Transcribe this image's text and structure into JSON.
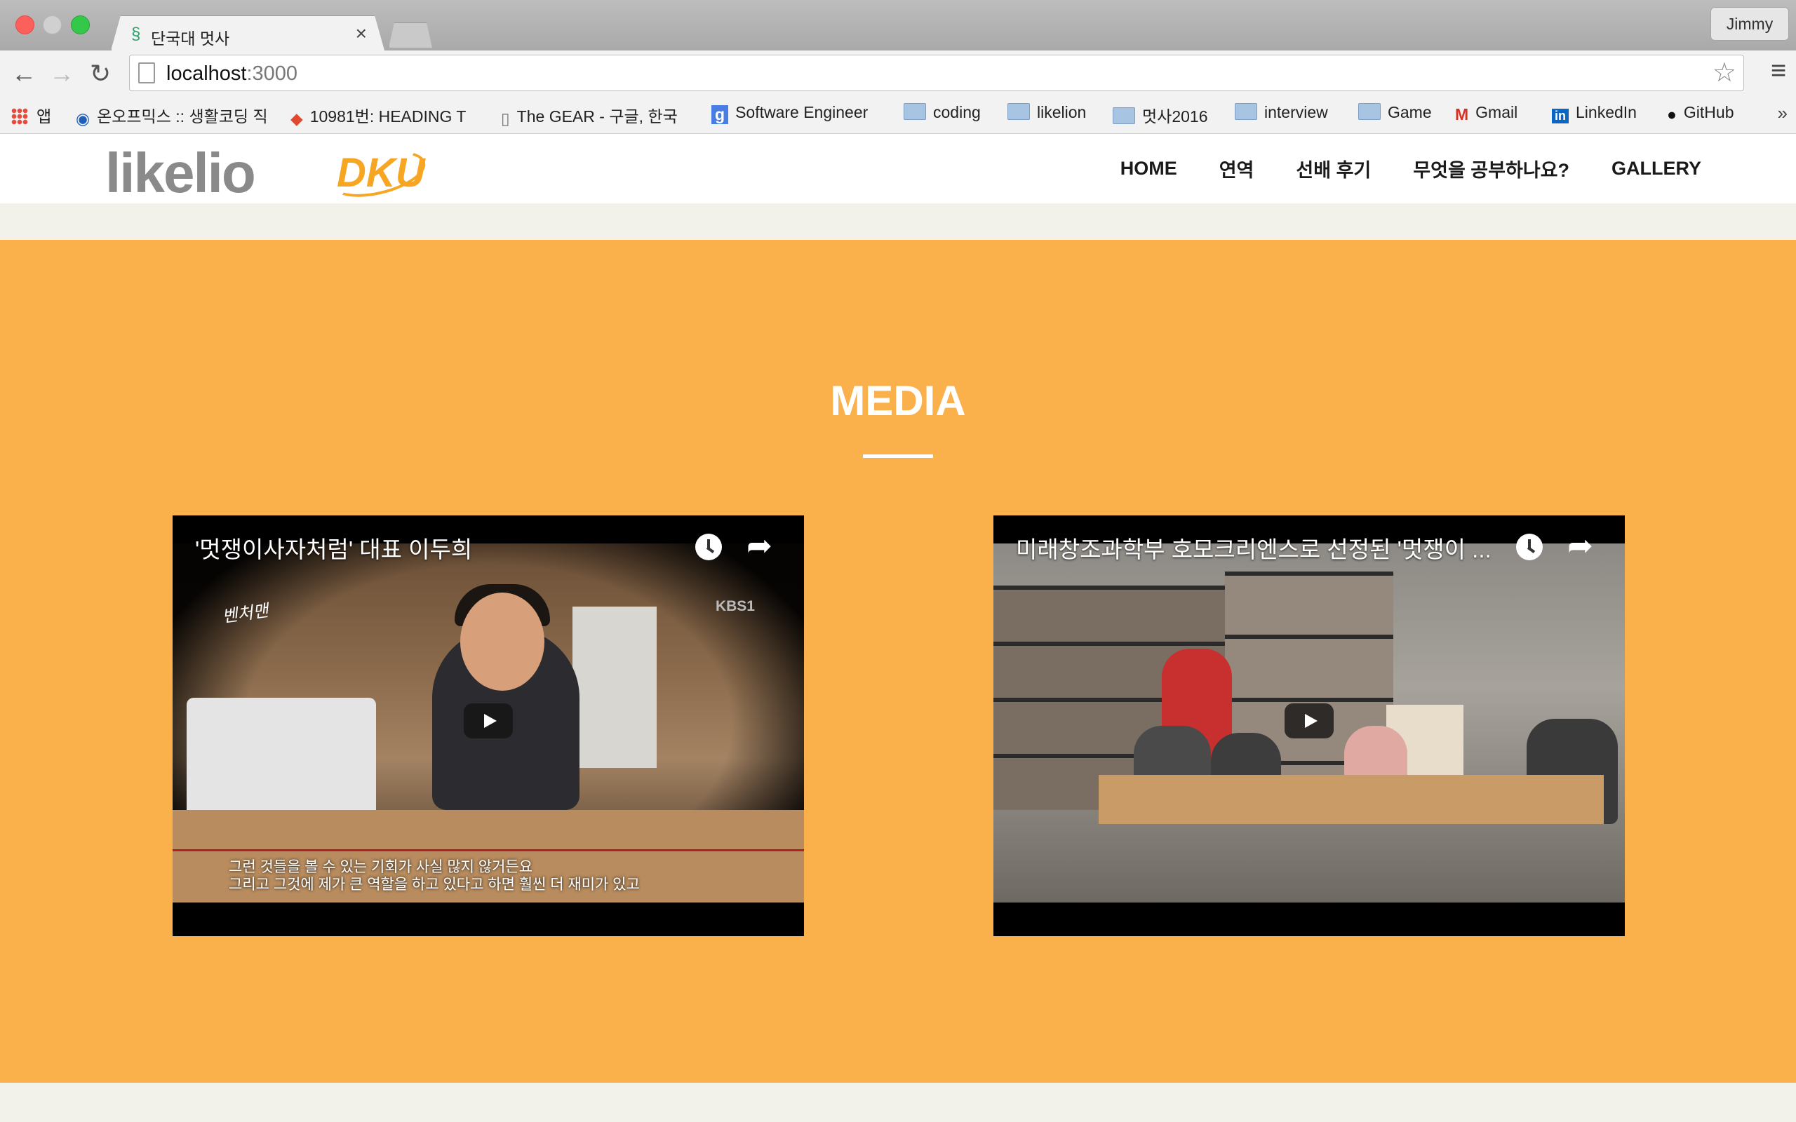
{
  "browser": {
    "tab_title": "단국대 멋사",
    "profile_name": "Jimmy",
    "url_host": "localhost",
    "url_port": ":3000",
    "bookmarks": [
      {
        "label": "앱",
        "icon": "apps-icon"
      },
      {
        "label": "온오프믹스 :: 생활코딩 직",
        "icon": "onoffmix-icon"
      },
      {
        "label": "10981번: HEADING T",
        "icon": "acmicpc-icon"
      },
      {
        "label": "The GEAR - 구글, 한국",
        "icon": "page-icon"
      },
      {
        "label": "Software Engineer",
        "icon": "google-icon"
      },
      {
        "label": "coding",
        "icon": "folder-icon"
      },
      {
        "label": "likelion",
        "icon": "folder-icon"
      },
      {
        "label": "멋사2016",
        "icon": "folder-icon"
      },
      {
        "label": "interview",
        "icon": "folder-icon"
      },
      {
        "label": "Game",
        "icon": "folder-icon"
      },
      {
        "label": "Gmail",
        "icon": "gmail-icon"
      },
      {
        "label": "LinkedIn",
        "icon": "linkedin-icon"
      },
      {
        "label": "GitHub",
        "icon": "github-icon"
      }
    ]
  },
  "site": {
    "logo_text": "likelion",
    "logo_badge": "DKU",
    "nav": [
      "HOME",
      "연역",
      "선배 후기",
      "무엇을 공부하나요?",
      "GALLERY"
    ]
  },
  "media": {
    "heading": "MEDIA",
    "videos": [
      {
        "title": "'멋쟁이사자처럼' 대표 이두희",
        "channel_mark": "KBS1",
        "subtitles": [
          "그런 것들을 볼 수 있는 기회가 사실 많지 않거든요",
          "그리고 그것에 제가 큰 역할을 하고 있다고 하면 훨씬 더 재미가 있고"
        ]
      },
      {
        "title": "미래창조과학부 호모크리엔스로 선정된 '멋쟁이 ...",
        "channel_mark": "",
        "subtitles": []
      }
    ]
  },
  "colors": {
    "accent": "#fab04b",
    "page_bg": "#f3f2ea",
    "logo_orange": "#f6a623"
  }
}
